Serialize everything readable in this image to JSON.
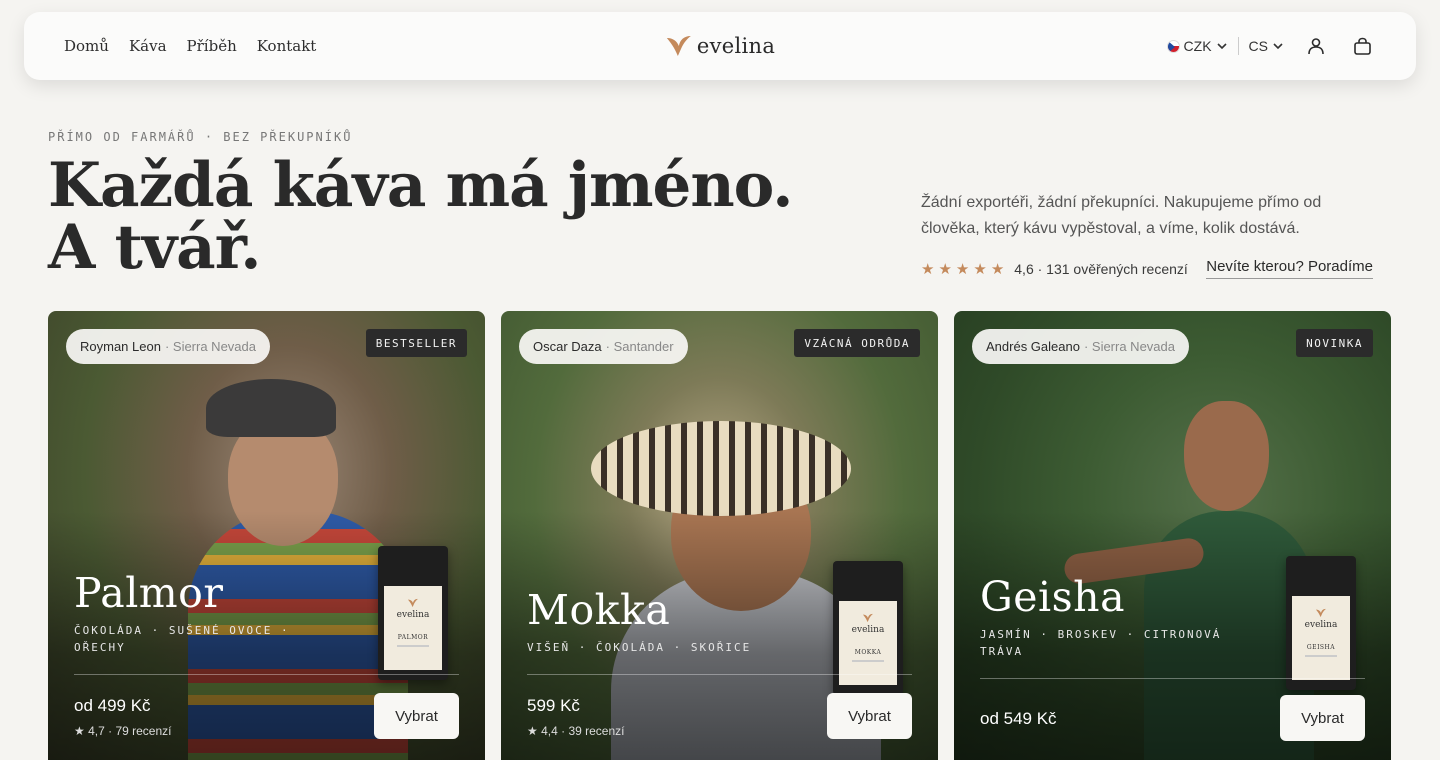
{
  "nav": {
    "links": [
      "Domů",
      "Káva",
      "Příběh",
      "Kontakt"
    ],
    "logo_text": "evelina",
    "currency": "CZK",
    "language": "CS",
    "icons": {
      "account": "user-icon",
      "cart": "bag-icon",
      "chevron": "chevron-down-icon",
      "flag": "czech-flag-icon"
    }
  },
  "hero": {
    "eyebrow": "PŘÍMO OD FARMÁŘŮ · BEZ PŘEKUPNÍKŮ",
    "headline_line1": "Každá káva má jméno.",
    "headline_line2": "A tvář.",
    "intro": "Žádní exportéři, žádní překupníci. Nakupujeme přímo od člověka, který kávu vypěstoval, a víme, kolik dostává.",
    "rating_stars": 5,
    "rating_text": "4,6 · 131 ověřených recenzí",
    "advice_link": "Nevíte kterou? Poradíme"
  },
  "colors": {
    "accent": "#c48a5c",
    "background": "#f5f4f1",
    "badge_bg": "#2b2b2b"
  },
  "products": [
    {
      "farmer": "Royman Leon",
      "region": "· Sierra Nevada",
      "badge": "BESTSELLER",
      "name": "Palmor",
      "notes_line1": "ČOKOLÁDA · SUŠENÉ OVOCE ·",
      "notes_line2": "OŘECHY",
      "pack_name": "PALMOR",
      "price": "od 499 Kč",
      "reviews": "4,7 · 79 recenzí",
      "cta": "Vybrat"
    },
    {
      "farmer": "Oscar Daza",
      "region": "· Santander",
      "badge": "VZÁCNÁ ODRŮDA",
      "name": "Mokka",
      "notes_line1": "VIŠEŇ · ČOKOLÁDA · SKOŘICE",
      "notes_line2": "",
      "pack_name": "MOKKA",
      "price": "599 Kč",
      "reviews": "4,4 · 39 recenzí",
      "cta": "Vybrat"
    },
    {
      "farmer": "Andrés Galeano",
      "region": "· Sierra Nevada",
      "badge": "NOVINKA",
      "name": "Geisha",
      "notes_line1": "JASMÍN · BROSKEV · CITRONOVÁ",
      "notes_line2": "TRÁVA",
      "pack_name": "GEISHA",
      "price": "od 549 Kč",
      "reviews": "",
      "cta": "Vybrat"
    }
  ]
}
